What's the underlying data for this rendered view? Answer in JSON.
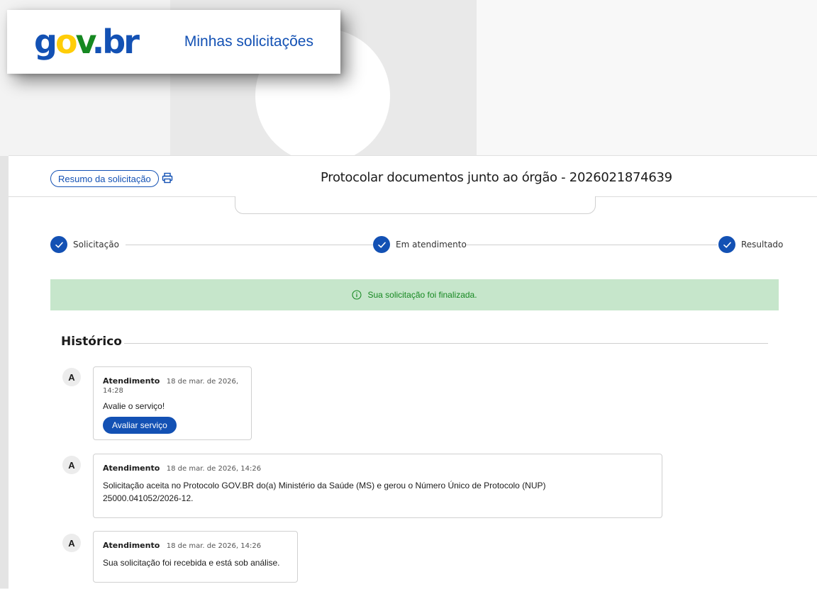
{
  "header": {
    "logo_text": "gov.br",
    "title": "Minhas solicitações"
  },
  "topbar": {
    "summary_button": "Resumo da solicitação",
    "page_title": "Protocolar documentos junto ao órgão - 2026021874639"
  },
  "stepper": {
    "steps": [
      {
        "label": "Solicitação",
        "status": "completed"
      },
      {
        "label": "Em atendimento",
        "status": "completed"
      },
      {
        "label": "Resultado",
        "status": "completed"
      }
    ]
  },
  "alert": {
    "text": "Sua solicitação foi finalizada."
  },
  "history": {
    "title": "Histórico",
    "events": [
      {
        "avatar": "A",
        "type": "Atendimento",
        "time": "18 de mar. de 2026, 14:28",
        "text": "Avalie o serviço!",
        "button": "Avaliar serviço"
      },
      {
        "avatar": "A",
        "type": "Atendimento",
        "time": "18 de mar. de 2026, 14:26",
        "text": "Solicitação aceita no Protocolo GOV.BR do(a) Ministério da Saúde (MS) e gerou o Número Único de Protocolo (NUP) 25000.041052/2026-12."
      },
      {
        "avatar": "A",
        "type": "Atendimento",
        "time": "18 de mar. de 2026, 14:26",
        "text": "Sua solicitação foi recebida e está sob análise."
      }
    ]
  },
  "colors": {
    "primary": "#1351b4",
    "success_bg": "#c6e6cb",
    "success_text": "#168821",
    "logo_yellow": "#ffcd07",
    "logo_green": "#168821"
  },
  "icons": {
    "print": "printer-icon",
    "info": "info-icon",
    "step": "check-icon"
  }
}
